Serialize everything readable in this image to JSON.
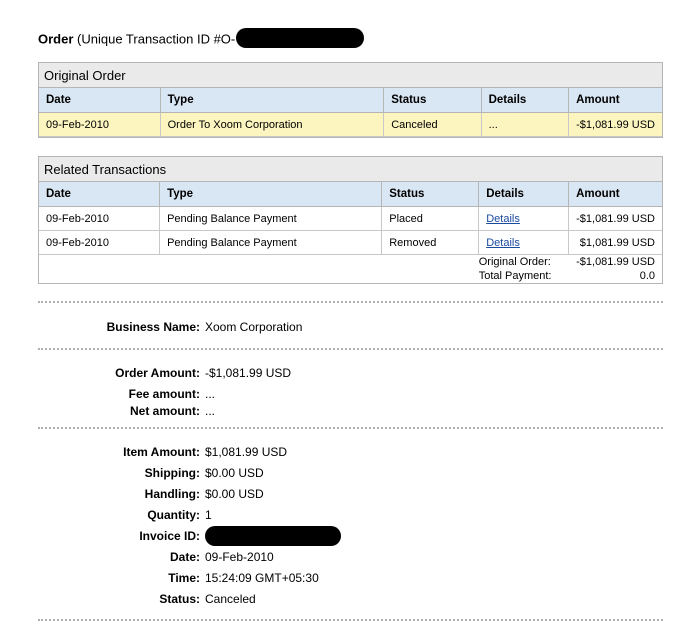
{
  "heading": {
    "bold": "Order",
    "rest": " (Unique Transaction ID #O-"
  },
  "original_order": {
    "title": "Original Order",
    "columns": [
      "Date",
      "Type",
      "Status",
      "Details",
      "Amount"
    ],
    "row": {
      "date": "09-Feb-2010",
      "type": "Order To Xoom Corporation",
      "status": "Canceled",
      "details": "...",
      "amount": "-$1,081.99 USD"
    }
  },
  "related": {
    "title": "Related Transactions",
    "columns": [
      "Date",
      "Type",
      "Status",
      "Details",
      "Amount"
    ],
    "rows": [
      {
        "date": "09-Feb-2010",
        "type": "Pending Balance Payment",
        "status": "Placed",
        "details": "Details",
        "amount": "-$1,081.99 USD"
      },
      {
        "date": "09-Feb-2010",
        "type": "Pending Balance Payment",
        "status": "Removed",
        "details": "Details",
        "amount": "$1,081.99 USD"
      }
    ],
    "totals": {
      "original_label": "Original Order:",
      "original_value": "-$1,081.99 USD",
      "payment_label": "Total Payment:",
      "payment_value": "0.0"
    }
  },
  "business": {
    "label": "Business Name:",
    "value": "Xoom Corporation"
  },
  "amounts": {
    "order_label": "Order Amount:",
    "order_value": "-$1,081.99 USD",
    "fee_label": "Fee amount:",
    "fee_value": "...",
    "net_label": "Net amount:",
    "net_value": "..."
  },
  "item": {
    "amount_label": "Item Amount:",
    "amount_value": "$1,081.99 USD",
    "shipping_label": "Shipping:",
    "shipping_value": "$0.00 USD",
    "handling_label": "Handling:",
    "handling_value": "$0.00 USD",
    "quantity_label": "Quantity:",
    "quantity_value": "1",
    "invoice_label": "Invoice ID:",
    "date_label": "Date:",
    "date_value": "09-Feb-2010",
    "time_label": "Time:",
    "time_value": "15:24:09 GMT+05:30",
    "status_label": "Status:",
    "status_value": "Canceled"
  }
}
